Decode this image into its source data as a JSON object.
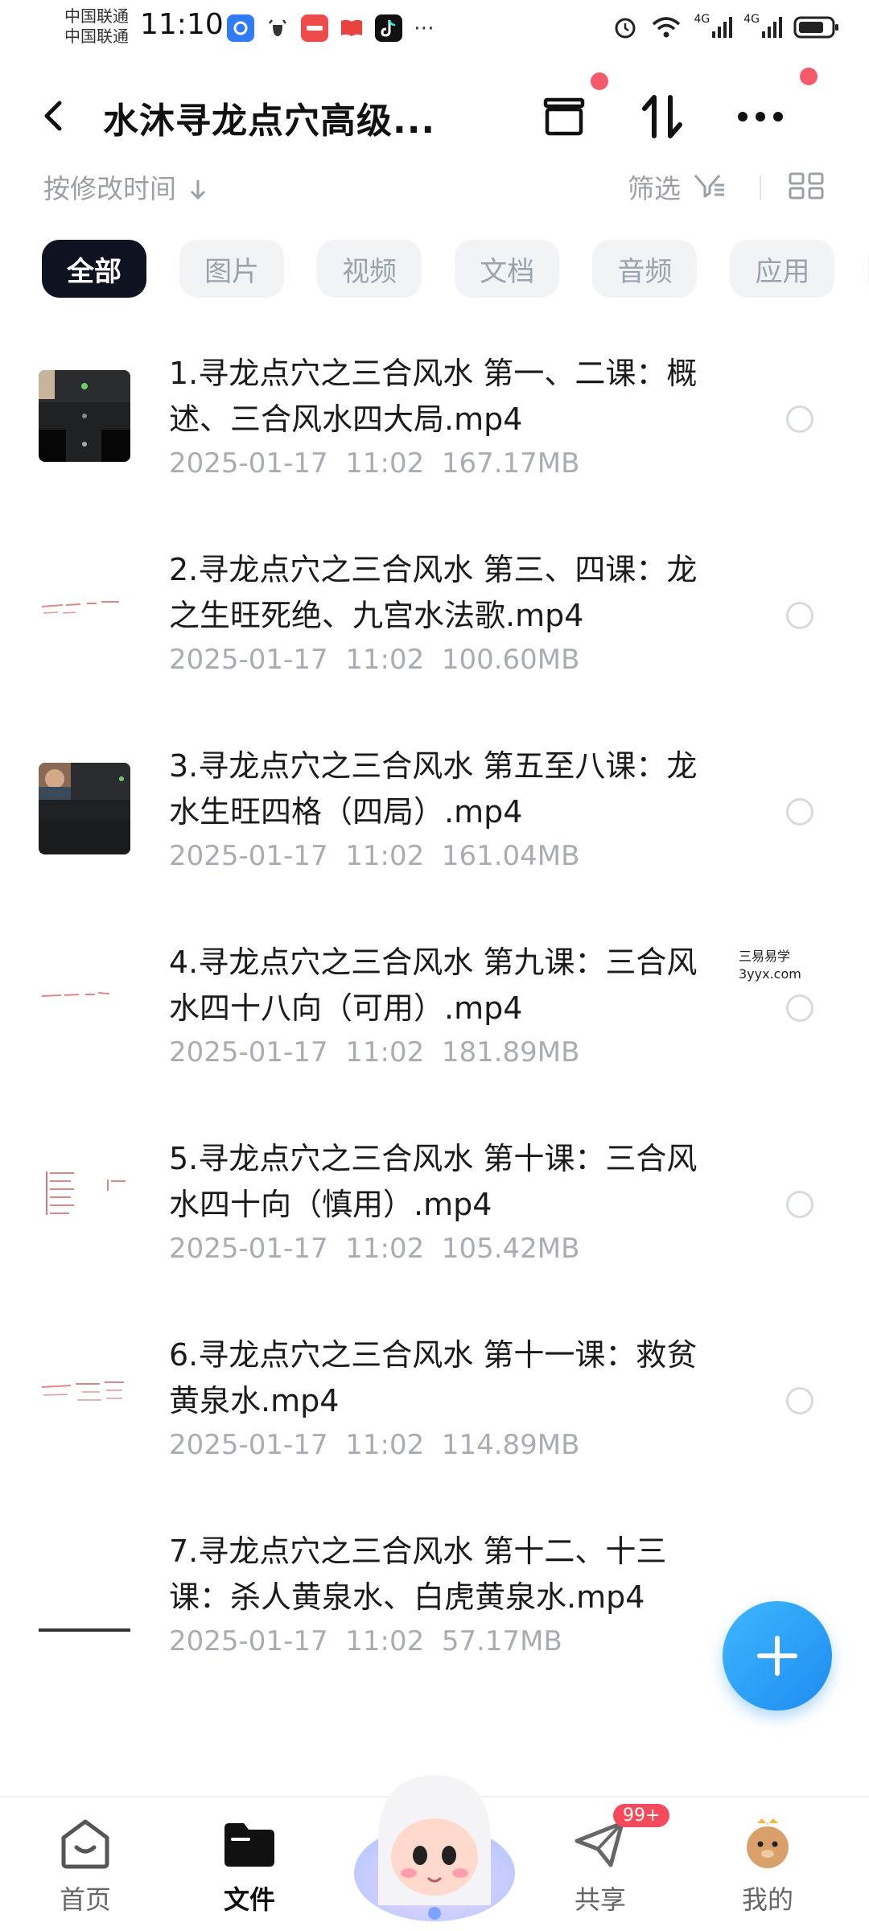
{
  "status_bar": {
    "carrier_1": "中国联通",
    "carrier_2": "中国联通",
    "time": "11:10",
    "net_1": "4G",
    "net_2": "4G"
  },
  "header": {
    "title": "水沐寻龙点穴高级..."
  },
  "sort_bar": {
    "sort_label": "按修改时间",
    "filter_label": "筛选"
  },
  "chips": [
    "全部",
    "图片",
    "视频",
    "文档",
    "音频",
    "应用"
  ],
  "files": [
    {
      "name": "1.寻龙点穴之三合风水 第一、二课：概述、三合风水四大局.mp4",
      "date": "2025-01-17",
      "time": "11:02",
      "size": "167.17MB",
      "thumb": "dark"
    },
    {
      "name": "2.寻龙点穴之三合风水 第三、四课：龙之生旺死绝、九宫水法歌.mp4",
      "date": "2025-01-17",
      "time": "11:02",
      "size": "100.60MB",
      "thumb": "note"
    },
    {
      "name": "3.寻龙点穴之三合风水 第五至八课：龙水生旺四格（四局）.mp4",
      "date": "2025-01-17",
      "time": "11:02",
      "size": "161.04MB",
      "thumb": "dark"
    },
    {
      "name": "4.寻龙点穴之三合风水 第九课：三合风水四十八向（可用）.mp4",
      "date": "2025-01-17",
      "time": "11:02",
      "size": "181.89MB",
      "thumb": "note"
    },
    {
      "name": "5.寻龙点穴之三合风水 第十课：三合风水四十向（慎用）.mp4",
      "date": "2025-01-17",
      "time": "11:02",
      "size": "105.42MB",
      "thumb": "note"
    },
    {
      "name": "6.寻龙点穴之三合风水 第十一课：救贫黄泉水.mp4",
      "date": "2025-01-17",
      "time": "11:02",
      "size": "114.89MB",
      "thumb": "note"
    },
    {
      "name": "7.寻龙点穴之三合风水 第十二、十三课：杀人黄泉水、白虎黄泉水.mp4",
      "date": "2025-01-17",
      "time": "11:02",
      "size": "57.17MB",
      "thumb": "none"
    }
  ],
  "watermark": {
    "line1": "三易易学",
    "line2": "3yyx.com"
  },
  "bottom_nav": [
    {
      "label": "首页",
      "icon": "home-icon",
      "active": false
    },
    {
      "label": "文件",
      "icon": "folder-icon",
      "active": true
    },
    {
      "label": "共享",
      "icon": "paper-plane-icon",
      "active": false,
      "badge": "99+"
    },
    {
      "label": "我的",
      "icon": "avatar-icon",
      "active": false
    }
  ],
  "colors": {
    "accent_blue": "#1d8cf0",
    "active_chip": "#0f1220",
    "badge_red": "#f54a5c",
    "meta_gray": "#a8adb3"
  }
}
